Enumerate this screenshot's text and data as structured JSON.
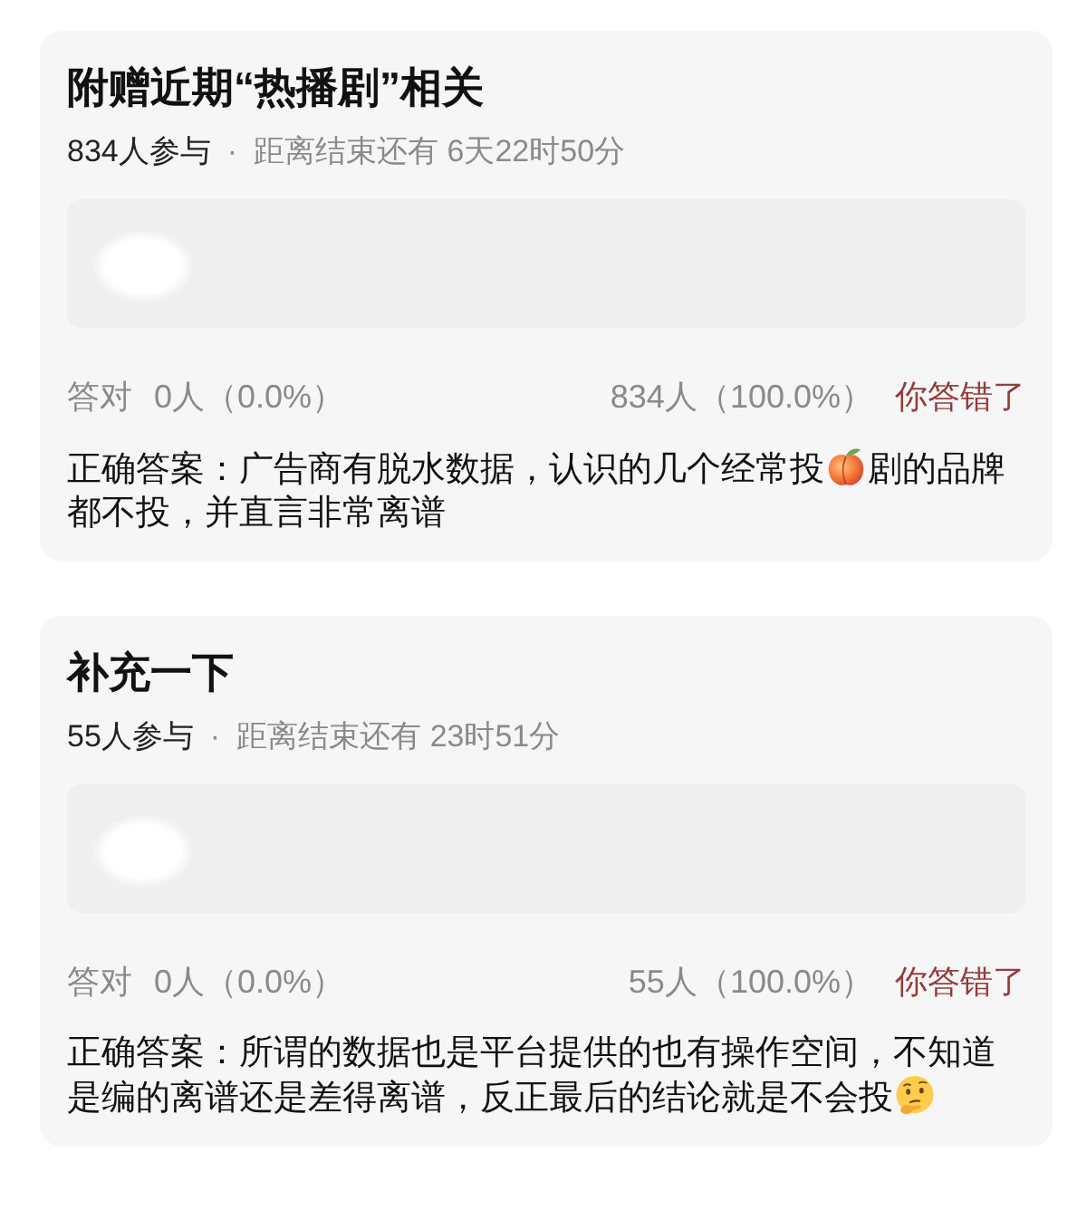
{
  "cards": [
    {
      "title": "附赠近期“热播剧”相关",
      "participants": "834人参与",
      "separator": "·",
      "countdown": "距离结束还有 6天22时50分",
      "stats": {
        "correct_label": "答对",
        "correct_count": "0人（0.0%）",
        "wrong_count": "834人（100.0%）",
        "verdict": "你答错了"
      },
      "answer_lines": [
        [
          {
            "kind": "text",
            "text": "正确答案：广告商有脱水数据，认识的几个经常投"
          },
          {
            "kind": "peach"
          },
          {
            "kind": "text",
            "text": "剧的品牌"
          }
        ],
        [
          {
            "kind": "text",
            "text": "都不投，并直言非常离谱"
          }
        ]
      ]
    },
    {
      "title": "补充一下",
      "participants": "55人参与",
      "separator": "·",
      "countdown": "距离结束还有 23时51分",
      "stats": {
        "correct_label": "答对",
        "correct_count": "0人（0.0%）",
        "wrong_count": "55人（100.0%）",
        "verdict": "你答错了"
      },
      "answer_lines": [
        [
          {
            "kind": "text",
            "text": "正确答案：所谓的数据也是平台提供的也有操作空间，不知道"
          }
        ],
        [
          {
            "kind": "text",
            "text": "是编的离谱还是差得离谱，反正最后的结论就是不会投"
          },
          {
            "kind": "thinking"
          }
        ]
      ]
    }
  ]
}
